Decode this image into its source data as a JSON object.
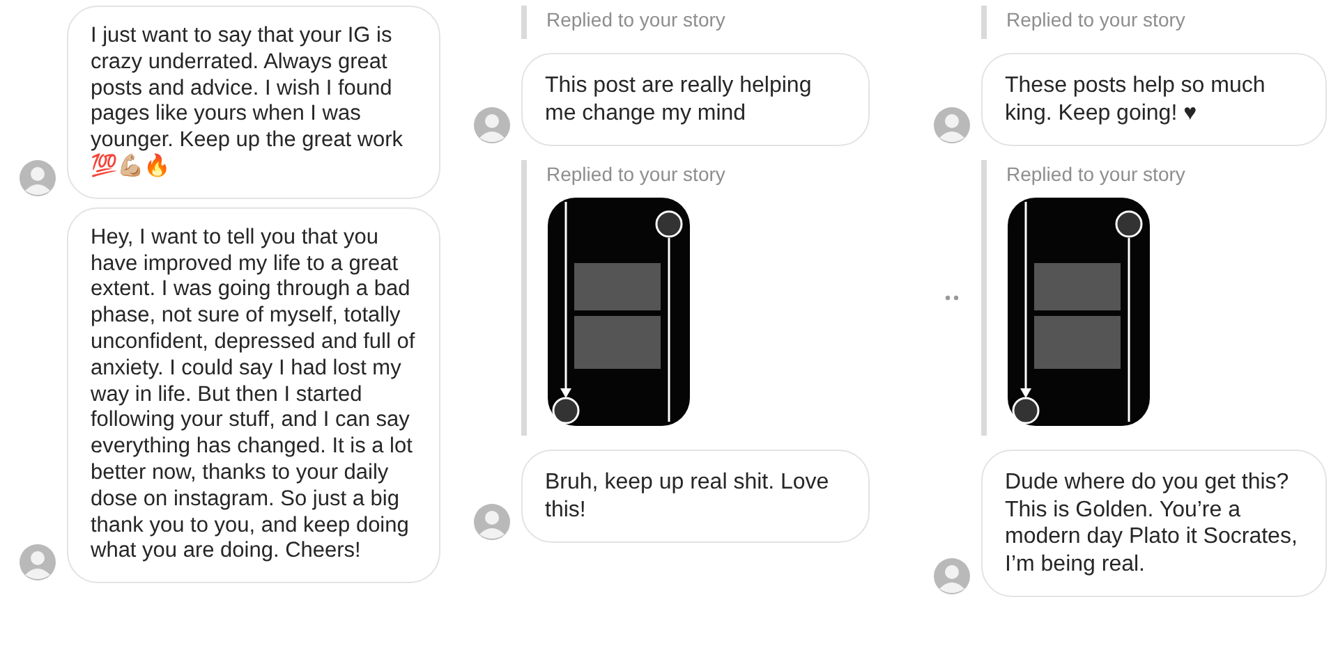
{
  "panels": [
    {
      "items": [
        {
          "kind": "message",
          "text": "I just want to say that your IG is crazy underrated. Always great posts and advice. I wish I found pages like yours when I was younger. Keep up the great work 💯💪🏼🔥"
        },
        {
          "kind": "message",
          "text": "Hey, I want to tell you that you have improved my life to a great extent. I was going through a bad phase, not sure of myself, totally unconfident, depressed and full of anxiety. I could say I had lost my way in life. But then I started following your stuff, and I can say everything has changed. It is a lot better now, thanks to your daily dose on instagram. So just a big thank you to you, and keep doing what you are doing. Cheers!"
        }
      ]
    },
    {
      "items": [
        {
          "kind": "story_reply",
          "label": "Replied to your story",
          "preview": false
        },
        {
          "kind": "message",
          "text": "This post are really helping me change my mind"
        },
        {
          "kind": "story_reply",
          "label": "Replied to your story",
          "preview": true
        },
        {
          "kind": "message",
          "text": "Bruh, keep up real shit. Love this!"
        }
      ]
    },
    {
      "items": [
        {
          "kind": "story_reply",
          "label": "Replied to your story",
          "preview": false
        },
        {
          "kind": "message",
          "text": "These posts help so much king. Keep going! ♥"
        },
        {
          "kind": "story_reply",
          "label": "Replied to your story",
          "preview": true,
          "dots": true
        },
        {
          "kind": "message",
          "text": "Dude where do you get this? This is Golden. You’re a modern day Plato it Socrates, I’m being real."
        }
      ]
    }
  ]
}
